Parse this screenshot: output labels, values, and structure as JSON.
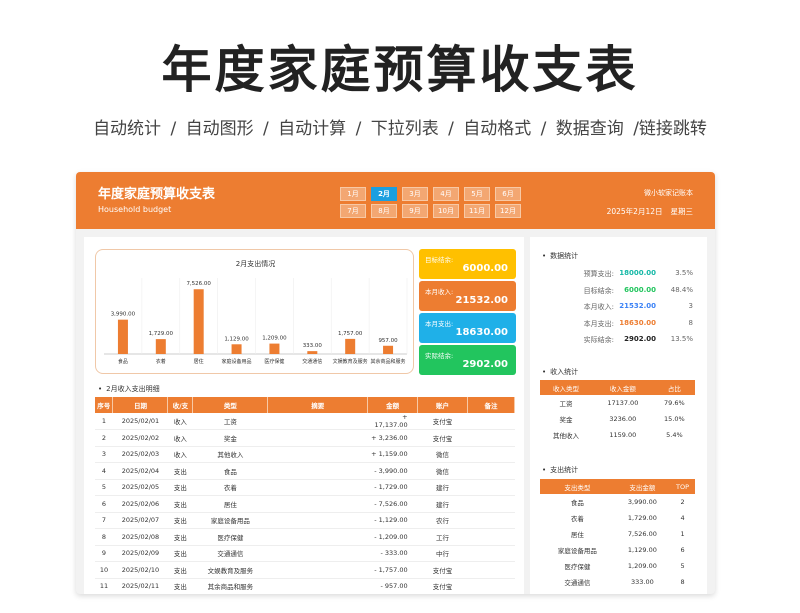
{
  "hero": {
    "title": "年度家庭预算收支表",
    "features": [
      "自动统计",
      "/",
      "自动图形",
      "/",
      "自动计算",
      "/",
      "下拉列表",
      "/",
      "自动格式",
      "/",
      "数据查询",
      "/链接跳转"
    ]
  },
  "header": {
    "title": "年度家庭预算收支表",
    "subtitle": "Household budget",
    "brand": "微小软家记账本",
    "date": "2025年2月12日",
    "weekday": "星期三",
    "months": [
      "1月",
      "2月",
      "3月",
      "4月",
      "5月",
      "6月",
      "7月",
      "8月",
      "9月",
      "10月",
      "11月",
      "12月"
    ],
    "active_month": "2月"
  },
  "chart_data": {
    "type": "bar",
    "title": "2月支出情况",
    "categories": [
      "食品",
      "衣着",
      "居住",
      "家庭设备用品",
      "医疗保健",
      "交通通信",
      "文娱教育及服务",
      "其余商品和服务"
    ],
    "values": [
      3990,
      1729,
      7526,
      1129,
      1209,
      333,
      1757,
      957
    ],
    "value_labels": [
      "3,990.00",
      "1,729.00",
      "7,526.00",
      "1,129.00",
      "1,209.00",
      "333.00",
      "1,757.00",
      "957.00"
    ],
    "bar_color": "#ed7d31"
  },
  "cards": [
    {
      "label": "目标结余:",
      "value": "6000.00",
      "color": "#ffc000"
    },
    {
      "label": "本月收入:",
      "value": "21532.00",
      "color": "#ed7d31"
    },
    {
      "label": "本月支出:",
      "value": "18630.00",
      "color": "#1fb0e8"
    },
    {
      "label": "实际结余:",
      "value": "2902.00",
      "color": "#22c55e"
    }
  ],
  "detail": {
    "title": "2月收入支出明细",
    "columns": [
      "序号",
      "日期",
      "收/支",
      "类型",
      "摘要",
      "金额",
      "账户",
      "备注"
    ],
    "rows": [
      [
        "1",
        "2025/02/01",
        "收入",
        "工资",
        "",
        "+ 17,137.00",
        "支付宝",
        ""
      ],
      [
        "2",
        "2025/02/02",
        "收入",
        "奖金",
        "",
        "+ 3,236.00",
        "支付宝",
        ""
      ],
      [
        "3",
        "2025/02/03",
        "收入",
        "其他收入",
        "",
        "+ 1,159.00",
        "微信",
        ""
      ],
      [
        "4",
        "2025/02/04",
        "支出",
        "食品",
        "",
        "- 3,990.00",
        "微信",
        ""
      ],
      [
        "5",
        "2025/02/05",
        "支出",
        "衣着",
        "",
        "- 1,729.00",
        "建行",
        ""
      ],
      [
        "6",
        "2025/02/06",
        "支出",
        "居住",
        "",
        "- 7,526.00",
        "建行",
        ""
      ],
      [
        "7",
        "2025/02/07",
        "支出",
        "家庭设备用品",
        "",
        "- 1,129.00",
        "农行",
        ""
      ],
      [
        "8",
        "2025/02/08",
        "支出",
        "医疗保健",
        "",
        "- 1,209.00",
        "工行",
        ""
      ],
      [
        "9",
        "2025/02/09",
        "支出",
        "交通通信",
        "",
        "- 333.00",
        "中行",
        ""
      ],
      [
        "10",
        "2025/02/10",
        "支出",
        "文娱教育及服务",
        "",
        "- 1,757.00",
        "支付宝",
        ""
      ],
      [
        "11",
        "2025/02/11",
        "支出",
        "其余商品和服务",
        "",
        "- 957.00",
        "支付宝",
        ""
      ]
    ]
  },
  "stats": {
    "title": "数据统计",
    "rows": [
      {
        "label": "预算支出:",
        "value": "18000.00",
        "pct": "3.5%",
        "color": "#14b8a6"
      },
      {
        "label": "目标结余:",
        "value": "6000.00",
        "pct": "48.4%",
        "color": "#22c55e"
      },
      {
        "label": "本月收入:",
        "value": "21532.00",
        "pct": "3",
        "color": "#3b82f6"
      },
      {
        "label": "本月支出:",
        "value": "18630.00",
        "pct": "8",
        "color": "#ed7d31"
      },
      {
        "label": "实际结余:",
        "value": "2902.00",
        "pct": "13.5%",
        "color": "#222222"
      }
    ]
  },
  "income": {
    "title": "收入统计",
    "columns": [
      "收入类型",
      "收入金额",
      "占比"
    ],
    "rows": [
      [
        "工资",
        "17137.00",
        "79.6%"
      ],
      [
        "奖金",
        "3236.00",
        "15.0%"
      ],
      [
        "其他收入",
        "1159.00",
        "5.4%"
      ]
    ]
  },
  "expense": {
    "title": "支出统计",
    "columns": [
      "支出类型",
      "支出金额",
      "TOP"
    ],
    "rows": [
      [
        "食品",
        "3,990.00",
        "2"
      ],
      [
        "衣着",
        "1,729.00",
        "4"
      ],
      [
        "居住",
        "7,526.00",
        "1"
      ],
      [
        "家庭设备用品",
        "1,129.00",
        "6"
      ],
      [
        "医疗保健",
        "1,209.00",
        "5"
      ],
      [
        "交通通信",
        "333.00",
        "8"
      ]
    ]
  }
}
